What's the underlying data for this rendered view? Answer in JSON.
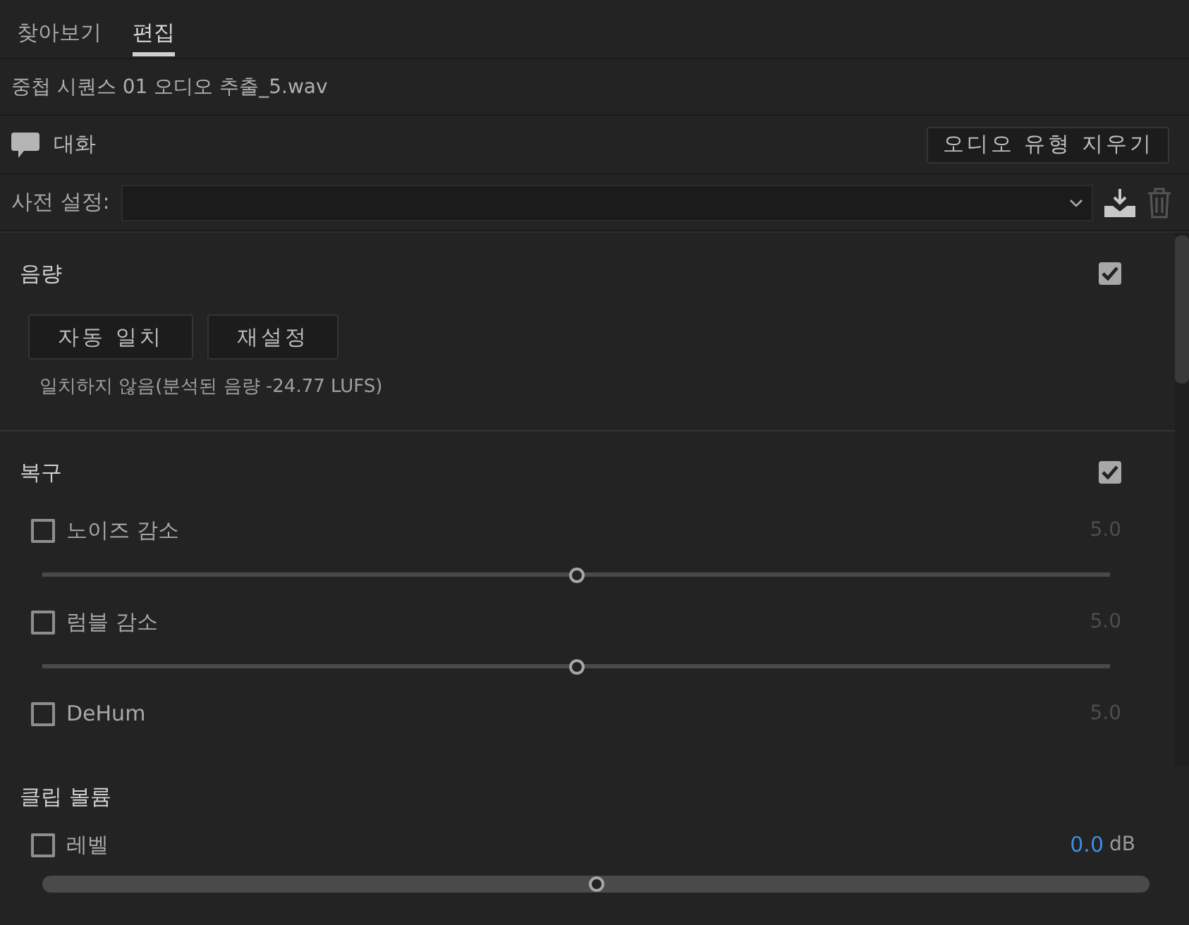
{
  "tabs": [
    {
      "label": "찾아보기",
      "selected": false
    },
    {
      "label": "편집",
      "selected": true
    }
  ],
  "clip_name": "중첩 시퀀스 01 오디오 추출_5.wav",
  "audio_type": {
    "label": "대화",
    "clear_button": "오디오 유형 지우기"
  },
  "preset": {
    "label": "사전 설정:"
  },
  "loudness": {
    "title": "음량",
    "checked": true,
    "buttons": [
      "자동 일치",
      "재설정"
    ],
    "status": "일치하지 않음(분석된 음량 -24.77 LUFS)"
  },
  "repair": {
    "title": "복구",
    "checked": true,
    "items": [
      {
        "label": "노이즈 감소",
        "checked": false,
        "value": "5.0",
        "level": 0.5
      },
      {
        "label": "럼블 감소",
        "checked": false,
        "value": "5.0",
        "level": 0.5
      },
      {
        "label": "DeHum",
        "checked": false,
        "value": "5.0"
      }
    ]
  },
  "clip_volume": {
    "title": "클립 볼륨",
    "level_item": {
      "label": "레벨",
      "checked": false,
      "value": "0.0",
      "unit": "dB",
      "level": 0.5
    }
  }
}
